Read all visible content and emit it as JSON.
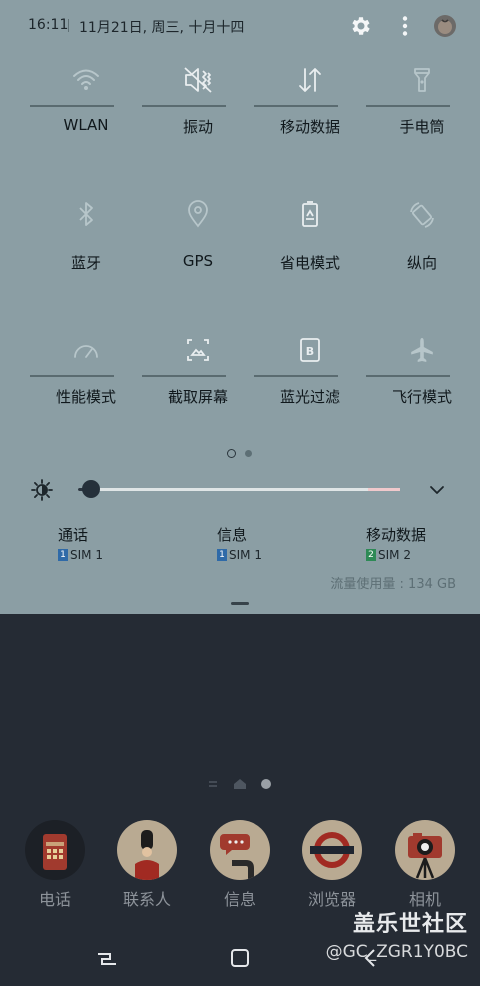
{
  "status_bar": {
    "time": "16:11",
    "date": "11月21日, 周三, 十月十四",
    "icons": [
      "gear-icon",
      "more-vert-icon",
      "avatar"
    ]
  },
  "quick_settings": {
    "tiles": [
      {
        "label": "WLAN",
        "icon": "wifi-icon"
      },
      {
        "label": "振动",
        "icon": "vibrate-icon"
      },
      {
        "label": "移动数据",
        "icon": "mobile-data-icon"
      },
      {
        "label": "手电筒",
        "icon": "flashlight-icon"
      },
      {
        "label": "蓝牙",
        "icon": "bluetooth-icon"
      },
      {
        "label": "GPS",
        "icon": "location-icon"
      },
      {
        "label": "省电模式",
        "icon": "power-saving-icon"
      },
      {
        "label": "纵向",
        "icon": "rotation-icon"
      },
      {
        "label": "性能模式",
        "icon": "performance-icon"
      },
      {
        "label": "截取屏幕",
        "icon": "screenshot-icon"
      },
      {
        "label": "蓝光过滤",
        "icon": "blue-light-filter-icon"
      },
      {
        "label": "飞行模式",
        "icon": "airplane-icon"
      }
    ],
    "page_indicator": {
      "pages": 2,
      "current": 1
    }
  },
  "brightness": {
    "level": 0.04
  },
  "sim_settings": [
    {
      "title": "通话",
      "sim_number": "1",
      "sim_label": "SIM 1",
      "badge_color": "#2f6aa8"
    },
    {
      "title": "信息",
      "sim_number": "1",
      "sim_label": "SIM 1",
      "badge_color": "#2f6aa8"
    },
    {
      "title": "移动数据",
      "sim_number": "2",
      "sim_label": "SIM 2",
      "badge_color": "#2e8a56"
    }
  ],
  "data_usage": "流量使用量 : 134 GB",
  "dock": [
    {
      "label": "电话",
      "icon": "phone-booth-icon"
    },
    {
      "label": "联系人",
      "icon": "contacts-guard-icon"
    },
    {
      "label": "信息",
      "icon": "messages-pipe-icon"
    },
    {
      "label": "浏览器",
      "icon": "browser-underground-icon"
    },
    {
      "label": "相机",
      "icon": "camera-icon"
    }
  ],
  "watermark": {
    "line1": "盖乐世社区",
    "line2": "@GC_ZGR1Y0BC"
  },
  "colors": {
    "panel_bg": "#8b9ea4",
    "home_bg": "#252b34",
    "icon": "#e9eef0",
    "text": "#10181c"
  }
}
